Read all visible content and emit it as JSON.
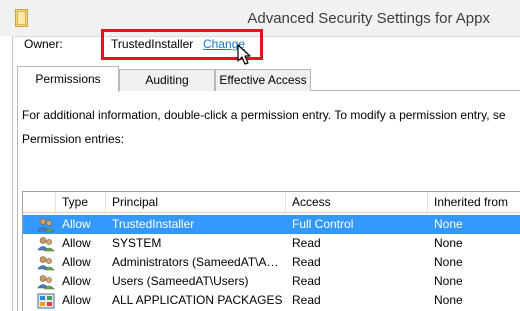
{
  "window": {
    "title": "Advanced Security Settings for Appx",
    "title_icon": "folder-icon"
  },
  "owner": {
    "label": "Owner:",
    "value": "TrustedInstaller",
    "change_link": "Change"
  },
  "tabs": [
    {
      "label": "Permissions",
      "active": true
    },
    {
      "label": "Auditing",
      "active": false
    },
    {
      "label": "Effective Access",
      "active": false
    }
  ],
  "permissions": {
    "info_text": "For additional information, double-click a permission entry. To modify a permission entry, se",
    "entries_label": "Permission entries:",
    "columns": [
      "Type",
      "Principal",
      "Access",
      "Inherited from"
    ],
    "rows": [
      {
        "icon": "user-group-icon",
        "type": "Allow",
        "principal": "TrustedInstaller",
        "access": "Full Control",
        "inherited": "None",
        "selected": true
      },
      {
        "icon": "user-group-icon",
        "type": "Allow",
        "principal": "SYSTEM",
        "access": "Read",
        "inherited": "None",
        "selected": false
      },
      {
        "icon": "user-group-icon",
        "type": "Allow",
        "principal": "Administrators (SameedAT\\A…",
        "access": "Read",
        "inherited": "None",
        "selected": false
      },
      {
        "icon": "user-group-icon",
        "type": "Allow",
        "principal": "Users (SameedAT\\Users)",
        "access": "Read",
        "inherited": "None",
        "selected": false
      },
      {
        "icon": "app-packages-icon",
        "type": "Allow",
        "principal": "ALL APPLICATION PACKAGES",
        "access": "Read",
        "inherited": "None",
        "selected": false
      }
    ]
  },
  "colors": {
    "highlight_border": "#e2141c",
    "link": "#1976c8",
    "selection": "#3399ff"
  }
}
